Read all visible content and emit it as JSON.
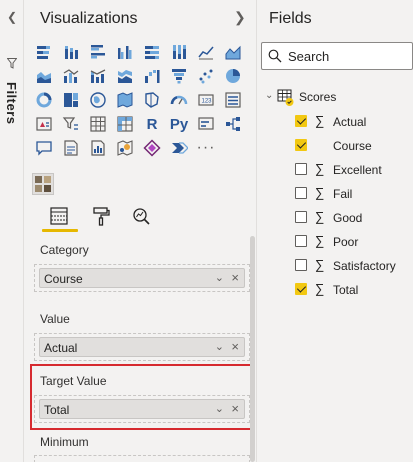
{
  "filters": {
    "label": "Filters"
  },
  "visualizations": {
    "title": "Visualizations",
    "icons": [
      "stacked-bar-icon",
      "stacked-column-icon",
      "clustered-bar-icon",
      "clustered-column-icon",
      "stacked-bar-100-icon",
      "stacked-column-100-icon",
      "line-chart-icon",
      "area-chart-icon",
      "stacked-area-icon",
      "line-clustered-column-icon",
      "line-stacked-column-icon",
      "ribbon-chart-icon",
      "waterfall-icon",
      "funnel-chart-icon",
      "scatter-chart-icon",
      "pie-chart-icon",
      "donut-chart-icon",
      "treemap-icon",
      "map-icon",
      "filled-map-icon",
      "shape-map-icon",
      "gauge-icon",
      "card-icon",
      "multi-row-card-icon",
      "kpi-icon",
      "slicer-icon",
      "table-icon",
      "matrix-icon",
      "r-visual-icon",
      "python-visual-icon",
      "key-influencers-icon",
      "decomposition-tree-icon",
      "qa-icon",
      "smart-narrative-icon",
      "paginated-report-icon",
      "arcgis-map-icon",
      "power-apps-icon",
      "power-automate-icon",
      "more-visuals-icon"
    ],
    "r_label": "R",
    "py_label": "Py",
    "more_label": "···",
    "wells": {
      "category": {
        "label": "Category",
        "field": "Course"
      },
      "value": {
        "label": "Value",
        "field": "Actual"
      },
      "target": {
        "label": "Target Value",
        "field": "Total"
      },
      "minimum": {
        "label": "Minimum"
      }
    }
  },
  "fields": {
    "title": "Fields",
    "search_placeholder": "Search",
    "table_name": "Scores",
    "sigma": "∑",
    "items": [
      {
        "name": "Actual",
        "checked": true,
        "sigma": true
      },
      {
        "name": "Course",
        "checked": true,
        "sigma": false
      },
      {
        "name": "Excellent",
        "checked": false,
        "sigma": true
      },
      {
        "name": "Fail",
        "checked": false,
        "sigma": true
      },
      {
        "name": "Good",
        "checked": false,
        "sigma": true
      },
      {
        "name": "Poor",
        "checked": false,
        "sigma": true
      },
      {
        "name": "Satisfactory",
        "checked": false,
        "sigma": true
      },
      {
        "name": "Total",
        "checked": true,
        "sigma": true
      }
    ]
  },
  "colors": {
    "accent": "#f2c811",
    "highlight": "#d62a2f",
    "icon": "#2b5797"
  }
}
